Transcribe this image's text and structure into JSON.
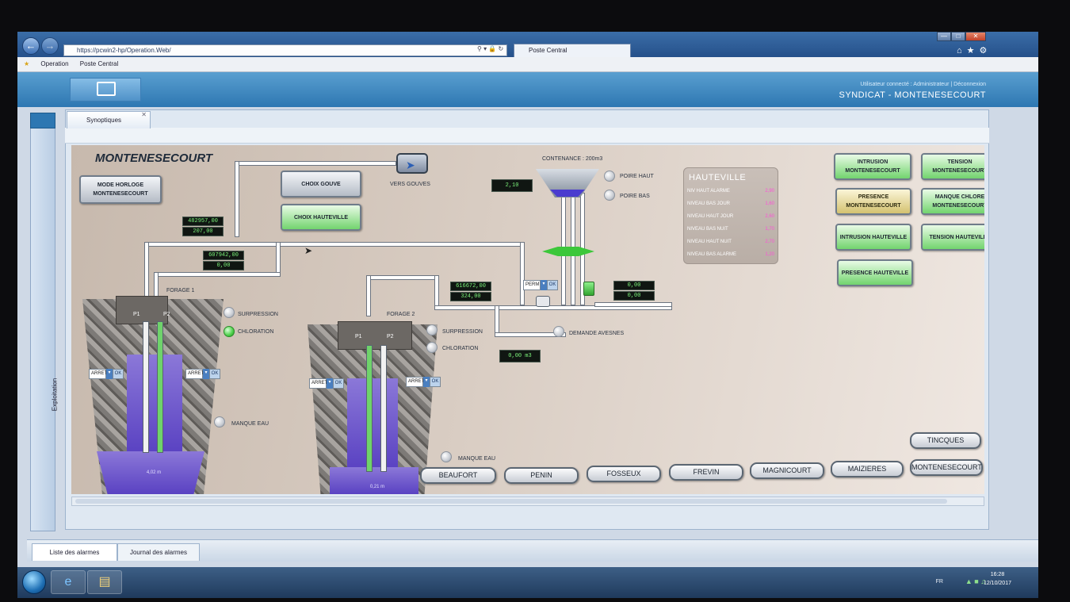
{
  "browser": {
    "url": "https://pcwin2-hp/Operation.Web/",
    "tab_title": "Poste Central",
    "favorites": [
      "Operation",
      "Poste Central"
    ]
  },
  "header": {
    "user_line": "Utilisateur connecté : Administrateur | Déconnexion",
    "organization": "SYNDICAT - MONTENESECOURT"
  },
  "side_rail": {
    "label": "Exploitation"
  },
  "tabs": {
    "synoptiques": "Synoptiques"
  },
  "synoptic": {
    "site_title": "MONTENESECOURT",
    "buttons": {
      "mode_horloge": "MODE HORLOGE MONTENESECOURT",
      "choix_gouve": "CHOIX GOUVE",
      "choix_hauteville": "CHOIX HAUTEVILLE",
      "vers_gouves": "VERS GOUVES"
    },
    "values": {
      "counter_1a": "482957,00",
      "counter_1b": "207,00",
      "counter_2a": "607942,00",
      "counter_2b": "0,00",
      "counter_3a": "616672,00",
      "counter_3b": "324,00",
      "level_reservoir": "2,10",
      "flow_right_1": "0,00",
      "flow_right_2": "0,00",
      "demand_volume": "0,00 m3"
    },
    "reservoir": {
      "contenance": "CONTENANCE : 200m3",
      "poire_haut": "POIRE HAUT",
      "poire_bas": "POIRE BAS"
    },
    "forage1": {
      "label": "FORAGE 1",
      "p1": "P1",
      "p2": "P2",
      "surpression": "SURPRESSION",
      "chloration": "CHLORATION",
      "manque_eau": "MANQUE EAU",
      "depth": "4,02 m",
      "sel1": "ARRET",
      "sel2": "ARRET",
      "ok": "OK"
    },
    "forage2": {
      "label": "FORAGE 2",
      "p1": "P1",
      "p2": "P2",
      "surpression": "SURPRESSION",
      "chloration": "CHLORATION",
      "manque_eau": "MANQUE EAU",
      "depth": "0,21 m",
      "sel1": "ARRET",
      "sel2": "ARRET",
      "ok": "OK"
    },
    "valve": {
      "mode": "PERM",
      "ok": "OK"
    },
    "demande_avesnes": "DEMANDE AVESNES",
    "hauteville": {
      "title": "HAUTEVILLE",
      "rows": [
        {
          "label": "NIV HAUT ALARME",
          "value": "2,90"
        },
        {
          "label": "NIVEAU BAS JOUR",
          "value": "1,60"
        },
        {
          "label": "NIVEAU HAUT JOUR",
          "value": "2,60"
        },
        {
          "label": "NIVEAU BAS NUIT",
          "value": "1,70"
        },
        {
          "label": "NIVEAU HAUT NUIT",
          "value": "2,70"
        },
        {
          "label": "NIVEAU BAS ALARME",
          "value": "1,20"
        }
      ]
    },
    "alarms": {
      "intrusion_montenescourt": "INTRUSION MONTENESECOURT",
      "tension_montenescourt": "TENSION MONTENESECOURT",
      "presence_montenescourt": "PRESENCE MONTENESECOURT",
      "manque_chlore": "MANQUE CHLORE MONTENESECOURT",
      "intrusion_hauteville": "INTRUSION HAUTEVILLE",
      "tension_hauteville": "TENSION HAUTEVILLE",
      "presence_hauteville": "PRESENCE HAUTEVILLE"
    },
    "sites": [
      "BEAUFORT",
      "PENIN",
      "FOSSEUX",
      "FREVIN",
      "MAGNICOURT",
      "MAIZIERES",
      "MONTENESECOURT"
    ],
    "site_tincques": "TINCQUES"
  },
  "bottom_tabs": [
    "Liste des alarmes",
    "Journal des alarmes"
  ],
  "taskbar": {
    "language": "FR",
    "time": "16:28",
    "date": "12/10/2017"
  }
}
